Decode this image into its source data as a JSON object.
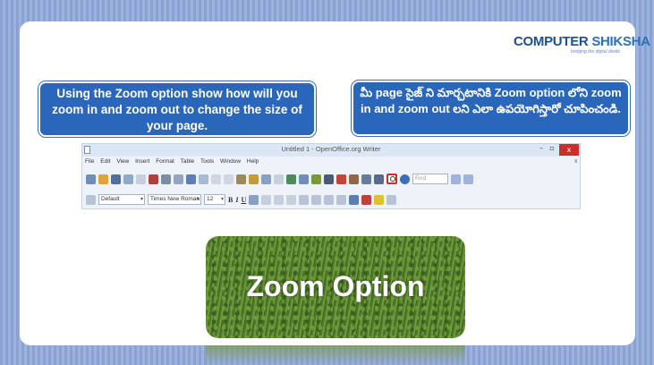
{
  "logo": {
    "brand": "COMPUTER",
    "brand_accent": "SHIKSHA",
    "tagline": "bridging the digital divide"
  },
  "callouts": {
    "english": "Using the Zoom option show how will you zoom in and zoom out to change the size of your page.",
    "telugu": "మీ page సైజ్ ని మార్చటానికి Zoom option లోని zoom in and zoom out లని ఎలా ఉపయోగిస్తారో చూపించండి."
  },
  "writer": {
    "title": "Untitled 1 - OpenOffice.org Writer",
    "menu": [
      "File",
      "Edit",
      "View",
      "Insert",
      "Format",
      "Table",
      "Tools",
      "Window",
      "Help"
    ],
    "menu_close": "x",
    "find_placeholder": "Find",
    "style_value": "Default",
    "font_value": "Times New Roman",
    "size_value": "12",
    "bold": "B",
    "italic": "I",
    "underline": "U",
    "window_min": "–",
    "window_max": "▫",
    "window_close": "x"
  },
  "zoom_card": {
    "label": "Zoom Option"
  },
  "colors": {
    "callout_bg": "#2a67bb",
    "frame_bg": "#9fb3dd",
    "highlight": "#d12b2b"
  }
}
